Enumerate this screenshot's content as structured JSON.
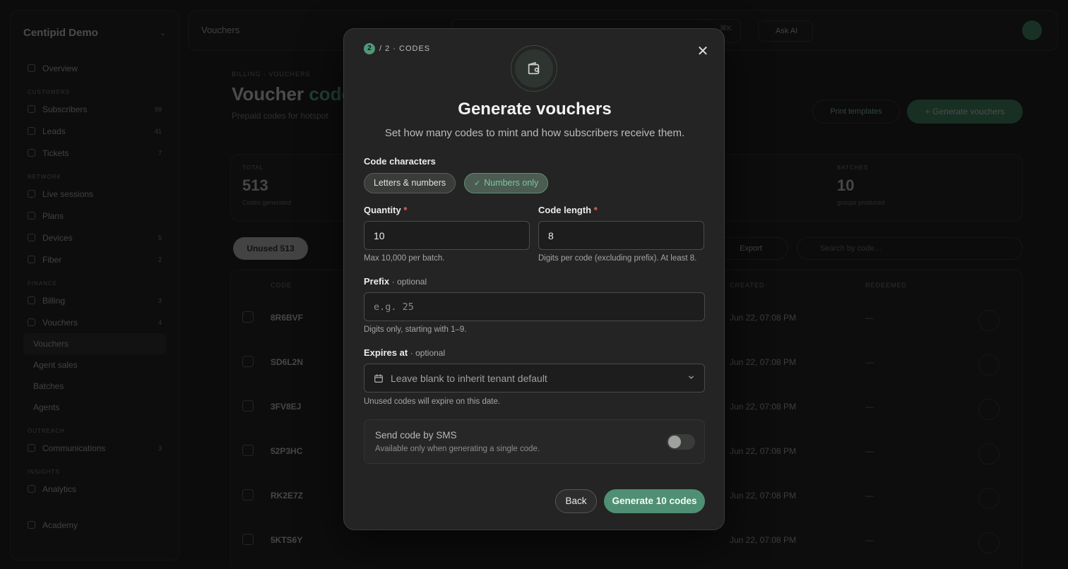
{
  "app": {
    "workspace": "Centipid Demo",
    "topbar_title": "Vouchers",
    "topbar_kbd": "⌘K",
    "ask_ai": "Ask AI",
    "avatar_initial": "C"
  },
  "sidebar": {
    "overview": "Overview",
    "group_customers": "CUSTOMERS",
    "subscribers": {
      "label": "Subscribers",
      "count": "99"
    },
    "leads": {
      "label": "Leads",
      "count": "41"
    },
    "tickets": {
      "label": "Tickets",
      "count": "7"
    },
    "group_network": "NETWORK",
    "live_sessions": "Live sessions",
    "plans": "Plans",
    "devices": {
      "label": "Devices",
      "count": "5"
    },
    "fiber": {
      "label": "Fiber",
      "count": "2"
    },
    "group_finance": "FINANCE",
    "billing": {
      "label": "Billing",
      "count": "3"
    },
    "vouchers": {
      "label": "Vouchers",
      "count": "4"
    },
    "vouchers_sub": "Vouchers",
    "agent_sales": "Agent sales",
    "batches": "Batches",
    "agents": "Agents",
    "group_outreach": "OUTREACH",
    "communications": {
      "label": "Communications",
      "count": "3"
    },
    "group_insights": "INSIGHTS",
    "analytics": "Analytics",
    "academy": "Academy"
  },
  "page": {
    "breadcrumb": "BILLING  ·  VOUCHERS",
    "title_main": "Voucher",
    "title_accent": "codes",
    "subtitle": "Prepaid codes for hotspot",
    "print_button": "Print templates",
    "generate_button": "+ Generate vouchers",
    "stats": {
      "total": {
        "label": "TOTAL",
        "value": "513",
        "sub": "Codes generated"
      },
      "batches": {
        "label": "BATCHES",
        "value": "10",
        "sub": "groups produced"
      }
    },
    "filter_unused": "Unused  513",
    "export": "Export",
    "search_placeholder": "Search by code…",
    "table": {
      "headers": {
        "code": "CODE",
        "created": "CREATED",
        "redeemed": "REDEEMED"
      },
      "rows": [
        {
          "code": "8R6BVF",
          "created": "Jun 22, 07:08 PM",
          "redeemed": "—"
        },
        {
          "code": "SD6L2N",
          "created": "Jun 22, 07:08 PM",
          "redeemed": "—"
        },
        {
          "code": "3FV8EJ",
          "created": "Jun 22, 07:08 PM",
          "redeemed": "—"
        },
        {
          "code": "52P3HC",
          "created": "Jun 22, 07:08 PM",
          "redeemed": "—"
        },
        {
          "code": "RK2E7Z",
          "created": "Jun 22, 07:08 PM",
          "redeemed": "—"
        },
        {
          "code": "5KTS6Y",
          "created": "Jun 22, 07:08 PM",
          "redeemed": "—"
        }
      ]
    }
  },
  "modal": {
    "step_number": "2",
    "step_text": "/ 2 · CODES",
    "title": "Generate vouchers",
    "subtitle": "Set how many codes to mint and how subscribers receive them.",
    "code_characters": {
      "label": "Code characters",
      "option_letters": "Letters & numbers",
      "option_numbers": "Numbers only",
      "selected": "Numbers only"
    },
    "quantity": {
      "label": "Quantity",
      "required_mark": "*",
      "value": "10",
      "help": "Max 10,000 per batch."
    },
    "code_length": {
      "label": "Code length",
      "required_mark": "*",
      "value": "8",
      "help": "Digits per code (excluding prefix). At least 8."
    },
    "prefix": {
      "label": "Prefix",
      "optional": "· optional",
      "placeholder": "e.g. 25",
      "help": "Digits only, starting with 1–9."
    },
    "expires_at": {
      "label": "Expires at",
      "optional": "· optional",
      "placeholder": "Leave blank to inherit tenant default",
      "help": "Unused codes will expire on this date."
    },
    "sms": {
      "title": "Send code by SMS",
      "subtitle": "Available only when generating a single code.",
      "enabled": false
    },
    "back_button": "Back",
    "submit_button": "Generate 10 codes"
  },
  "colors": {
    "accent": "#4f8f74",
    "accent_text": "#7fc6a1",
    "required": "#e06565",
    "modal_bg": "#232423"
  },
  "icons": {
    "hero": "wallet-icon",
    "close": "close-icon",
    "calendar": "calendar-icon",
    "dropdown": "chevron-down-icon",
    "check": "check-icon"
  }
}
